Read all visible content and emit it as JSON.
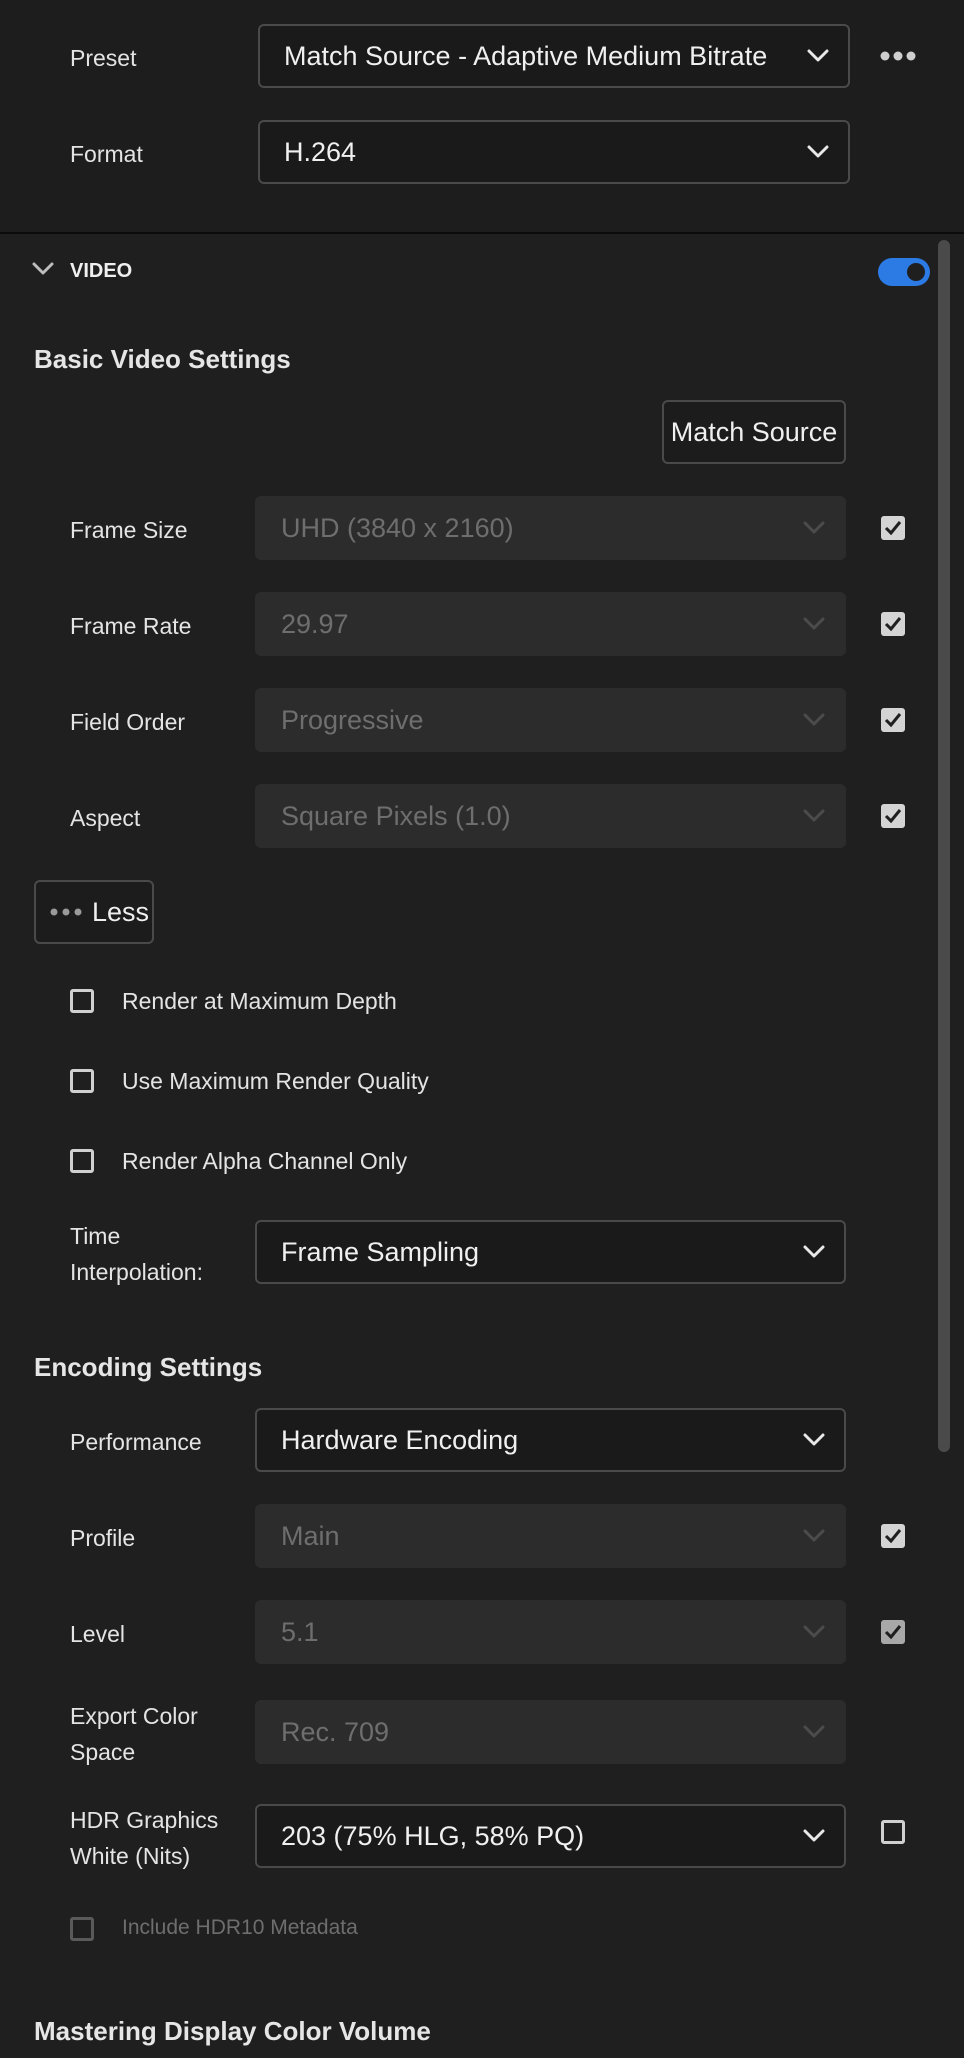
{
  "header": {
    "preset": {
      "label": "Preset",
      "value": "Match Source - Adaptive Medium Bitrate"
    },
    "format": {
      "label": "Format",
      "value": "H.264"
    }
  },
  "video": {
    "section_label": "VIDEO",
    "enabled": true,
    "basic": {
      "title": "Basic Video Settings",
      "match_source_label": "Match Source",
      "frame_size": {
        "label": "Frame Size",
        "value": "UHD (3840 x 2160)",
        "checked": true
      },
      "frame_rate": {
        "label": "Frame Rate",
        "value": "29.97",
        "checked": true
      },
      "field_order": {
        "label": "Field Order",
        "value": "Progressive",
        "checked": true
      },
      "aspect": {
        "label": "Aspect",
        "value": "Square Pixels (1.0)",
        "checked": true
      },
      "less_label": "Less",
      "render_max_depth": {
        "label": "Render at Maximum Depth",
        "checked": false
      },
      "max_render_quality": {
        "label": "Use Maximum Render Quality",
        "checked": false
      },
      "alpha_only": {
        "label": "Render Alpha Channel Only",
        "checked": false
      },
      "time_interp": {
        "label_line1": "Time",
        "label_line2": "Interpolation:",
        "value": "Frame Sampling"
      }
    },
    "encoding": {
      "title": "Encoding Settings",
      "performance": {
        "label": "Performance",
        "value": "Hardware Encoding"
      },
      "profile": {
        "label": "Profile",
        "value": "Main",
        "checked": true
      },
      "level": {
        "label": "Level",
        "value": "5.1",
        "checked": true
      },
      "color_space": {
        "label_line1": "Export Color",
        "label_line2": "Space",
        "value": "Rec. 709"
      },
      "hdr_white": {
        "label_line1": "HDR Graphics",
        "label_line2": "White (Nits)",
        "value": "203 (75% HLG, 58% PQ)",
        "checked": false
      },
      "hdr10": {
        "label": "Include HDR10 Metadata",
        "checked": false
      }
    },
    "mastering_title": "Mastering Display Color Volume"
  },
  "colors": {
    "accent": "#2c7be5",
    "panel_bg": "#1f1f1f",
    "field_disabled": "#2c2c2c"
  }
}
